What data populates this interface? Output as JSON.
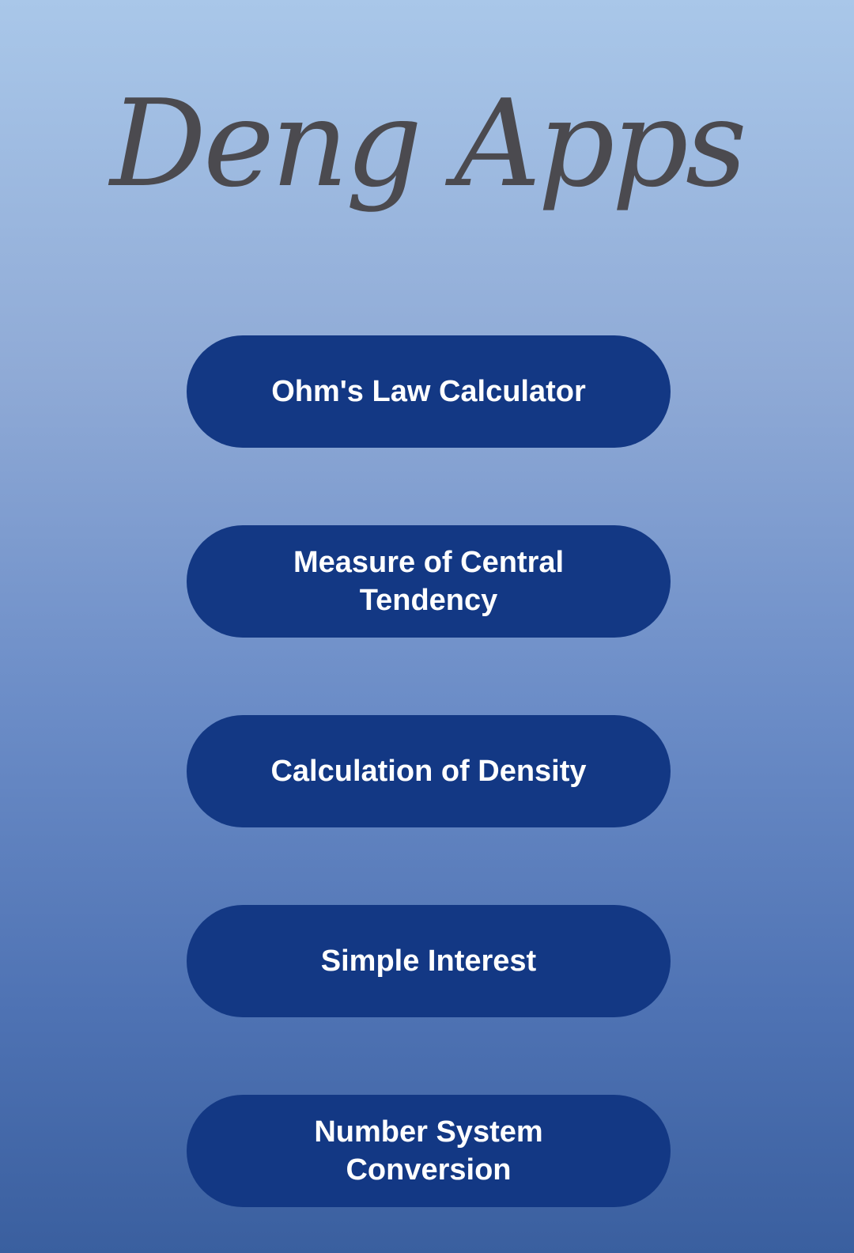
{
  "header": {
    "title": "Deng Apps"
  },
  "menu": {
    "items": [
      {
        "label": "Ohm's Law Calculator"
      },
      {
        "label": "Measure of Central Tendency"
      },
      {
        "label": "Calculation of Density"
      },
      {
        "label": "Simple Interest"
      },
      {
        "label": "Number System Conversion"
      }
    ]
  },
  "colors": {
    "button_background": "#133884",
    "button_text": "#ffffff",
    "title_text": "#4b4a4f",
    "background_top": "#a9c7e9",
    "background_bottom": "#3a5f9f"
  }
}
